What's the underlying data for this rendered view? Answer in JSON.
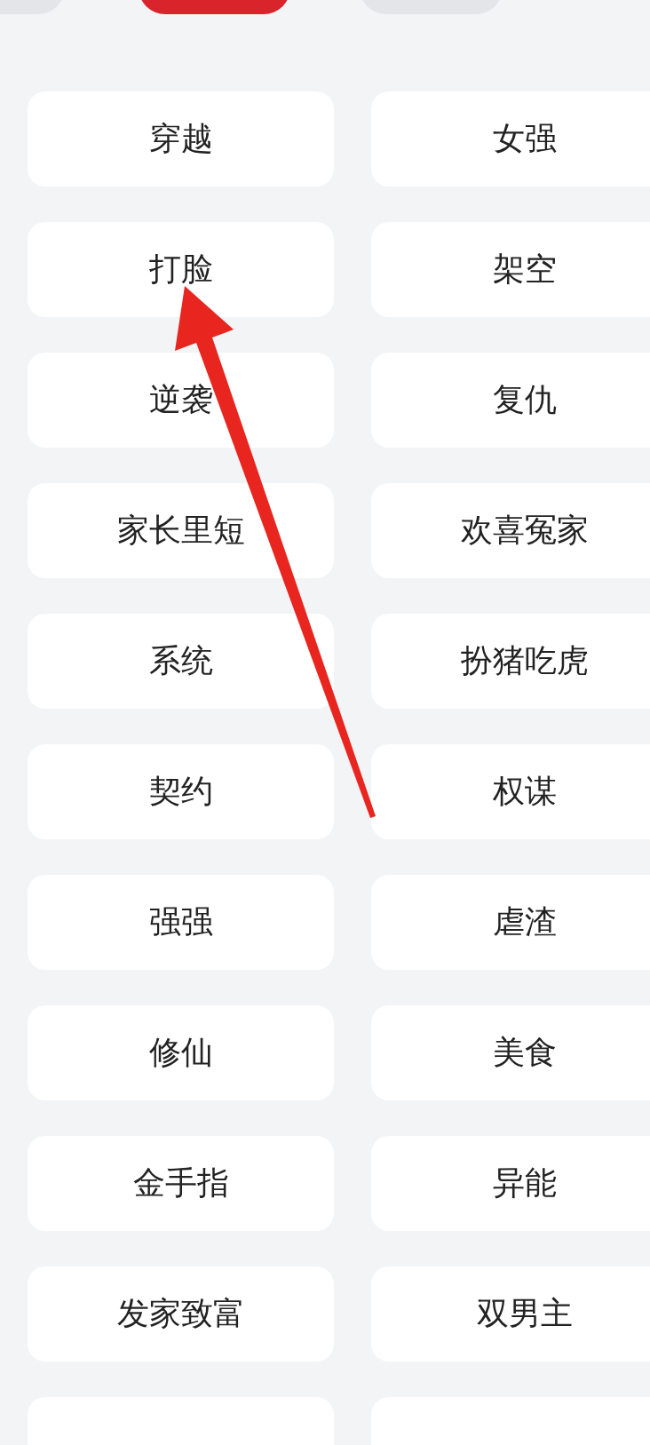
{
  "top_tabs": [
    {
      "selected": false
    },
    {
      "selected": true
    },
    {
      "selected": false
    }
  ],
  "tags": [
    "穿越",
    "女强",
    "打脸",
    "架空",
    "逆袭",
    "复仇",
    "家长里短",
    "欢喜冤家",
    "系统",
    "扮猪吃虎",
    "契约",
    "权谋",
    "强强",
    "虐渣",
    "修仙",
    "美食",
    "金手指",
    "异能",
    "发家致富",
    "双男主"
  ]
}
